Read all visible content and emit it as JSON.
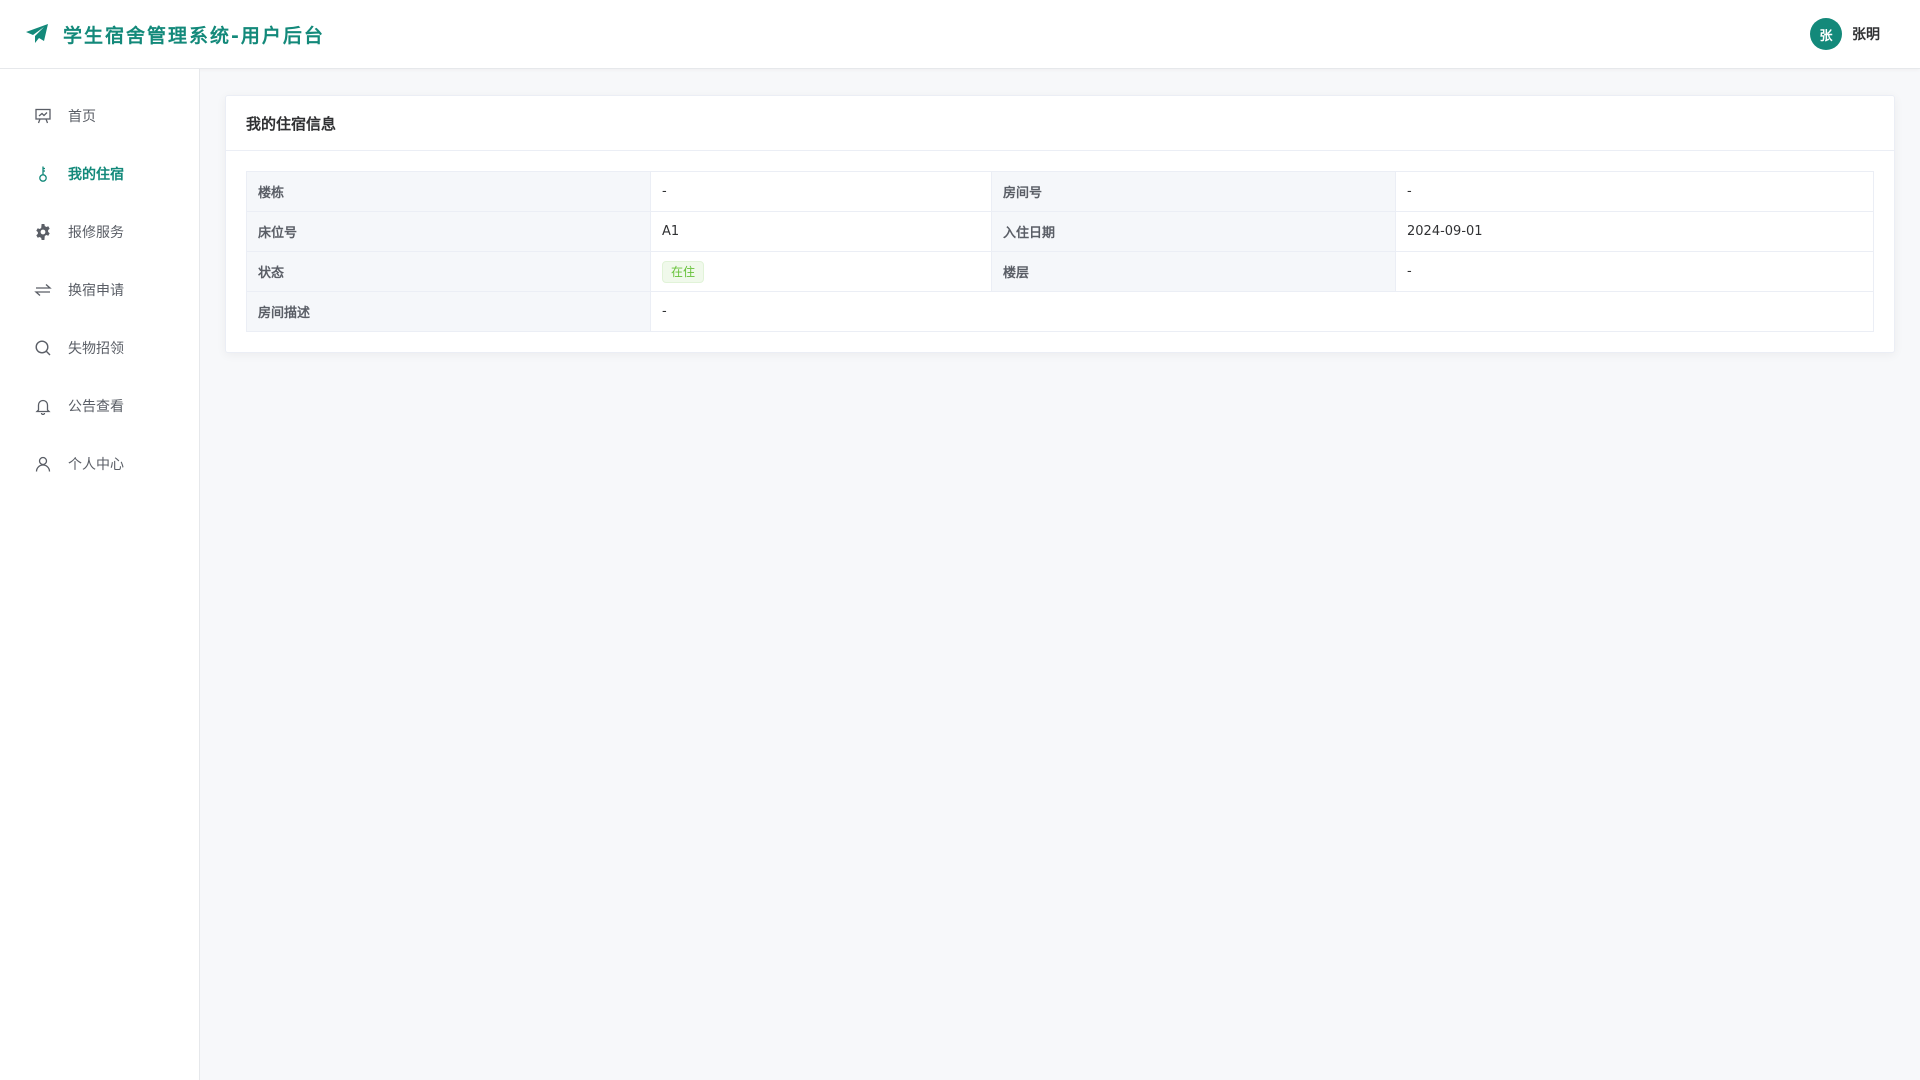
{
  "header": {
    "title": "学生宿舍管理系统-用户后台",
    "user": {
      "avatar_char": "张",
      "name": "张明"
    },
    "accent_color": "#13897a"
  },
  "sidebar": {
    "items": [
      {
        "label": "首页",
        "icon": "presentation-board-icon",
        "active": false
      },
      {
        "label": "我的住宿",
        "icon": "key-icon",
        "active": true
      },
      {
        "label": "报修服务",
        "icon": "gear-icon",
        "active": false
      },
      {
        "label": "换宿申请",
        "icon": "swap-arrows-icon",
        "active": false
      },
      {
        "label": "失物招领",
        "icon": "search-icon",
        "active": false
      },
      {
        "label": "公告查看",
        "icon": "bell-icon",
        "active": false
      },
      {
        "label": "个人中心",
        "icon": "user-icon",
        "active": false
      }
    ]
  },
  "main": {
    "card_title": "我的住宿信息",
    "rows": [
      {
        "label1": "楼栋",
        "value1": "-",
        "label2": "房间号",
        "value2": "-"
      },
      {
        "label1": "床位号",
        "value1": "A1",
        "label2": "入住日期",
        "value2": "2024-09-01"
      },
      {
        "label1": "状态",
        "value1": "在住",
        "label2": "楼层",
        "value2": "-"
      },
      {
        "label1": "房间描述",
        "value1": "-"
      }
    ],
    "status_tag_color": "#67c23a"
  }
}
